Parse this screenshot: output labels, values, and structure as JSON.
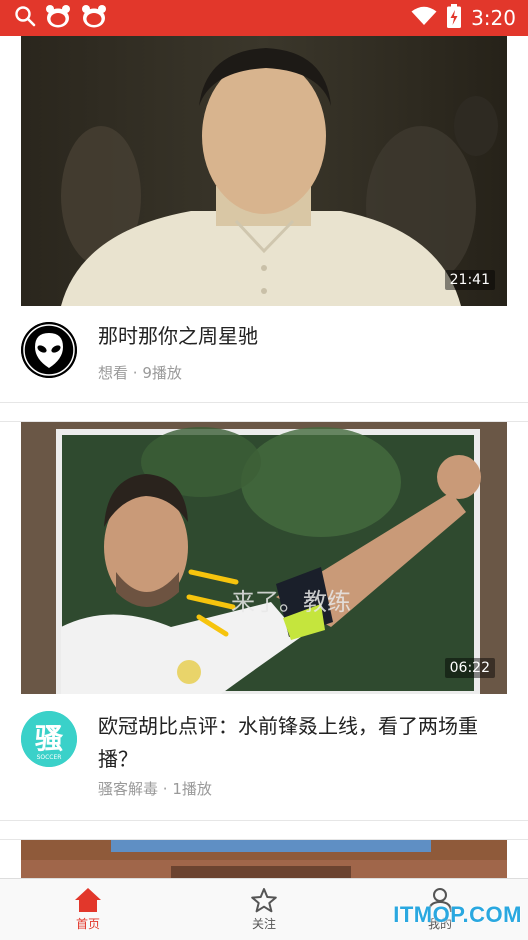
{
  "status_bar": {
    "time": "3:20"
  },
  "feed": [
    {
      "duration": "21:41",
      "title": "那时那你之周星驰",
      "author": "想看",
      "plays": "9播放",
      "avatar_icon": "alien-icon"
    },
    {
      "duration": "06:22",
      "title": "欧冠胡比点评：水前锋叒上线，看了两场重播？",
      "author": "骚客解毒",
      "plays": "1播放",
      "avatar_icon": "sao-soccer-logo",
      "overlay_caption": "来了。教练"
    }
  ],
  "tabs": [
    {
      "label": "首页",
      "icon": "home-icon",
      "active": true
    },
    {
      "label": "关注",
      "icon": "star-icon",
      "active": false
    },
    {
      "label": "我的",
      "icon": "user-icon",
      "active": false
    }
  ],
  "watermark": "ITMOP.COM",
  "colors": {
    "accent": "#e2372b",
    "watermark": "#2aa8e0"
  }
}
